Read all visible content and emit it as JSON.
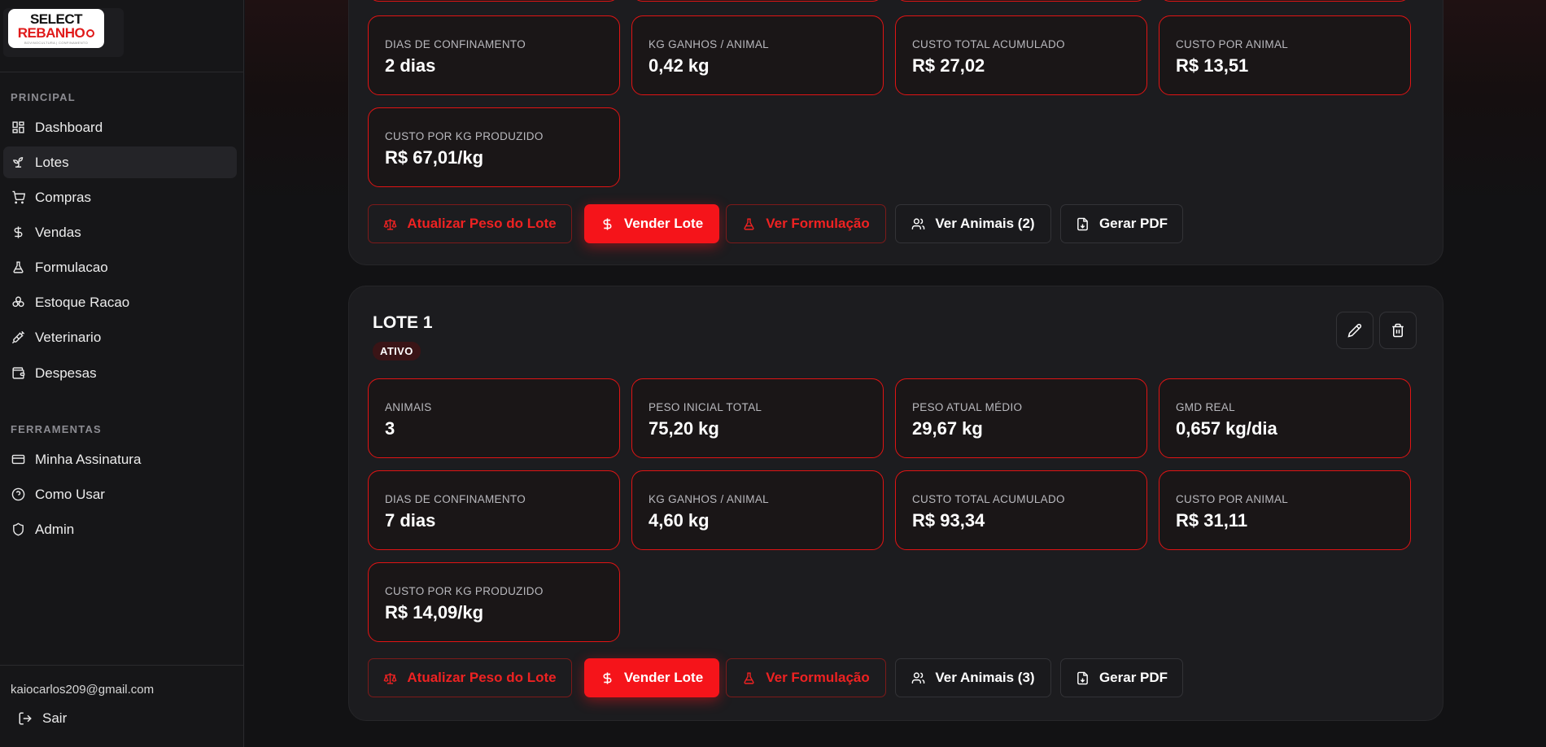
{
  "sidebar": {
    "logo": {
      "line1": "SELECT",
      "line2": "REBANHO",
      "tagline": "BOVINOCULTURA | CONFINAMENTO"
    },
    "sections": [
      {
        "label": "PRINCIPAL"
      },
      {
        "label": "FERRAMENTAS"
      }
    ],
    "items": [
      {
        "label": "Dashboard",
        "icon": "dashboard-icon"
      },
      {
        "label": "Lotes",
        "icon": "sprout-icon",
        "active": true
      },
      {
        "label": "Compras",
        "icon": "cart-icon"
      },
      {
        "label": "Vendas",
        "icon": "dollar-icon"
      },
      {
        "label": "Formulacao",
        "icon": "flask-icon"
      },
      {
        "label": "Estoque Racao",
        "icon": "grain-icon"
      },
      {
        "label": "Veterinario",
        "icon": "syringe-icon"
      },
      {
        "label": "Despesas",
        "icon": "wallet-icon"
      }
    ],
    "tools": [
      {
        "label": "Minha Assinatura",
        "icon": "credit-card-icon"
      },
      {
        "label": "Como Usar",
        "icon": "help-circle-icon"
      },
      {
        "label": "Admin",
        "icon": "shield-icon"
      }
    ],
    "user_email": "kaiocarlos209@gmail.com",
    "logout_label": "Sair"
  },
  "lotes": [
    {
      "stats_row2": [
        {
          "label": "DIAS DE CONFINAMENTO",
          "value": "2 dias"
        },
        {
          "label": "KG GANHOS / ANIMAL",
          "value": "0,42 kg"
        },
        {
          "label": "CUSTO TOTAL ACUMULADO",
          "value": "R$ 27,02"
        },
        {
          "label": "CUSTO POR ANIMAL",
          "value": "R$ 13,51"
        }
      ],
      "stats_row3": [
        {
          "label": "CUSTO POR KG PRODUZIDO",
          "value": "R$ 67,01/kg"
        }
      ],
      "buttons": {
        "update_weight": "Atualizar Peso do Lote",
        "sell": "Vender Lote",
        "formulation": "Ver Formulação",
        "animals": "Ver Animais (2)",
        "pdf": "Gerar PDF"
      }
    },
    {
      "title": "LOTE 1",
      "status": "ATIVO",
      "stats_row1": [
        {
          "label": "ANIMAIS",
          "value": "3"
        },
        {
          "label": "PESO INICIAL TOTAL",
          "value": "75,20 kg"
        },
        {
          "label": "PESO ATUAL MÉDIO",
          "value": "29,67 kg"
        },
        {
          "label": "GMD REAL",
          "value": "0,657 kg/dia"
        }
      ],
      "stats_row2": [
        {
          "label": "DIAS DE CONFINAMENTO",
          "value": "7 dias"
        },
        {
          "label": "KG GANHOS / ANIMAL",
          "value": "4,60 kg"
        },
        {
          "label": "CUSTO TOTAL ACUMULADO",
          "value": "R$ 93,34"
        },
        {
          "label": "CUSTO POR ANIMAL",
          "value": "R$ 31,11"
        }
      ],
      "stats_row3": [
        {
          "label": "CUSTO POR KG PRODUZIDO",
          "value": "R$ 14,09/kg"
        }
      ],
      "buttons": {
        "update_weight": "Atualizar Peso do Lote",
        "sell": "Vender Lote",
        "formulation": "Ver Formulação",
        "animals": "Ver Animais (3)",
        "pdf": "Gerar PDF"
      }
    }
  ],
  "colors": {
    "accent": "#f5141a",
    "card_border": "#e01414",
    "background": "#121214",
    "sidebar": "#161618"
  }
}
